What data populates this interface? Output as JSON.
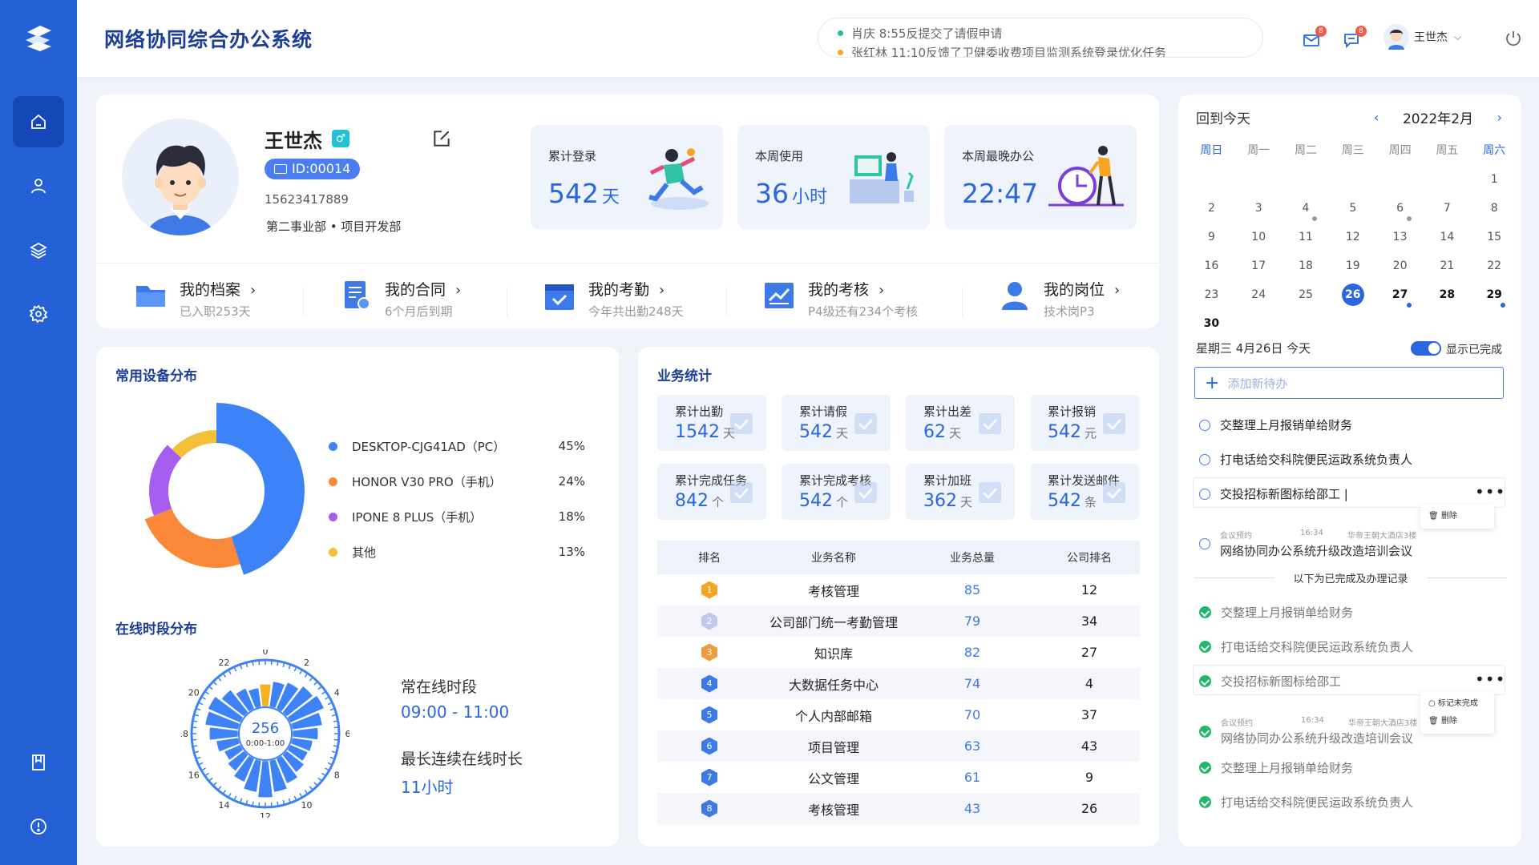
{
  "header": {
    "title": "网络协同综合办公系统",
    "notices": [
      "肖庆 8:55反提交了请假申请",
      "张红林 11:10反馈了卫健委收费项目监测系统登录优化任务"
    ],
    "mail_badge": "8",
    "msg_badge": "8",
    "username": "王世杰"
  },
  "profile": {
    "name": "王世杰",
    "gender": "♂",
    "id": "ID:00014",
    "phone": "15623417889",
    "dept": "第二事业部 • 项目开发部",
    "stats": [
      {
        "label": "累计登录",
        "value": "542",
        "unit": "天"
      },
      {
        "label": "本周使用",
        "value": "36",
        "unit": "小时"
      },
      {
        "label": "本周最晚办公",
        "value": "22:47",
        "unit": ""
      }
    ],
    "quick": [
      {
        "title": "我的档案",
        "sub": "已入职253天"
      },
      {
        "title": "我的合同",
        "sub": "6个月后到期"
      },
      {
        "title": "我的考勤",
        "sub": "今年共出勤248天"
      },
      {
        "title": "我的考核",
        "sub": "P4级还有234个考核"
      },
      {
        "title": "我的岗位",
        "sub": "技术岗P3"
      }
    ]
  },
  "devices": {
    "title": "常用设备分布",
    "items": [
      {
        "name": "DESKTOP-CJG41AD（PC）",
        "pct": "45%",
        "value": 45,
        "color": "#3d82f6"
      },
      {
        "name": "HONOR V30 PRO（手机）",
        "pct": "24%",
        "value": 24,
        "color": "#fb8838"
      },
      {
        "name": "IPONE 8 PLUS（手机）",
        "pct": "18%",
        "value": 18,
        "color": "#a65ef0"
      },
      {
        "name": "其他",
        "pct": "13%",
        "value": 13,
        "color": "#f4c038"
      }
    ],
    "online_title": "在线时段分布",
    "clock_center": "256",
    "clock_sub": "0:00-1:00",
    "clock_hours": [
      "0",
      "2",
      "4",
      "6",
      "8",
      "10",
      "12",
      "14",
      "16",
      "18",
      "20",
      "22"
    ],
    "frequent_label": "常在线时段",
    "frequent_value": "09:00 - 11:00",
    "longest_label": "最长连续在线时长",
    "longest_value": "11小时"
  },
  "business": {
    "title": "业务统计",
    "tiles": [
      {
        "label": "累计出勤",
        "value": "1542",
        "unit": "天"
      },
      {
        "label": "累计请假",
        "value": "542",
        "unit": "天"
      },
      {
        "label": "累计出差",
        "value": "62",
        "unit": "天"
      },
      {
        "label": "累计报销",
        "value": "542",
        "unit": "元"
      },
      {
        "label": "累计完成任务",
        "value": "842",
        "unit": "个"
      },
      {
        "label": "累计完成考核",
        "value": "542",
        "unit": "个"
      },
      {
        "label": "累计加班",
        "value": "362",
        "unit": "天"
      },
      {
        "label": "累计发送邮件",
        "value": "542",
        "unit": "条"
      }
    ],
    "table_headers": [
      "排名",
      "业务名称",
      "业务总量",
      "公司排名"
    ],
    "rows": [
      {
        "rank": "1",
        "name": "考核管理",
        "total": "85",
        "company": "12",
        "color": "#f5a623"
      },
      {
        "rank": "2",
        "name": "公司部门统一考勤管理",
        "total": "79",
        "company": "34",
        "color": "#c3c7ee"
      },
      {
        "rank": "3",
        "name": "知识库",
        "total": "82",
        "company": "27",
        "color": "#ef9b3f"
      },
      {
        "rank": "4",
        "name": "大数据任务中心",
        "total": "74",
        "company": "4",
        "color": "#3d7ae8"
      },
      {
        "rank": "5",
        "name": "个人内部邮箱",
        "total": "70",
        "company": "37",
        "color": "#3d7ae8"
      },
      {
        "rank": "6",
        "name": "项目管理",
        "total": "63",
        "company": "43",
        "color": "#3d7ae8"
      },
      {
        "rank": "7",
        "name": "公文管理",
        "total": "61",
        "company": "9",
        "color": "#3d7ae8"
      },
      {
        "rank": "8",
        "name": "考核管理",
        "total": "43",
        "company": "26",
        "color": "#3d7ae8"
      }
    ]
  },
  "calendar": {
    "back_today": "回到今天",
    "month": "2022年2月",
    "weekdays": [
      "周日",
      "周一",
      "周二",
      "周三",
      "周四",
      "周五",
      "周六"
    ],
    "today_text": "星期三 4月26日 今天",
    "show_done": "显示已完成",
    "add_placeholder": "添加新待办",
    "todos": [
      "交整理上月报销单给财务",
      "打电话给交科院便民运政系统负责人",
      "交投招标新图标给邵工 |"
    ],
    "meeting_meta": [
      "会议预约",
      "16:34",
      "华帝王朝大酒店3楼"
    ],
    "meeting_title": "网络协同办公系统升级改造培训会议",
    "menu_delete": "删除",
    "menu_mark_undone": "标记未完成",
    "done_divider": "以下为已完成及办理记录",
    "done_todos": [
      "交整理上月报销单给财务",
      "打电话给交科院便民运政系统负责人",
      "交投招标新图标给邵工"
    ],
    "done_meeting_title": "网络协同办公系统升级改造培训会议",
    "done_todos_2": [
      "交整理上月报销单给财务",
      "打电话给交科院便民运政系统负责人"
    ]
  }
}
